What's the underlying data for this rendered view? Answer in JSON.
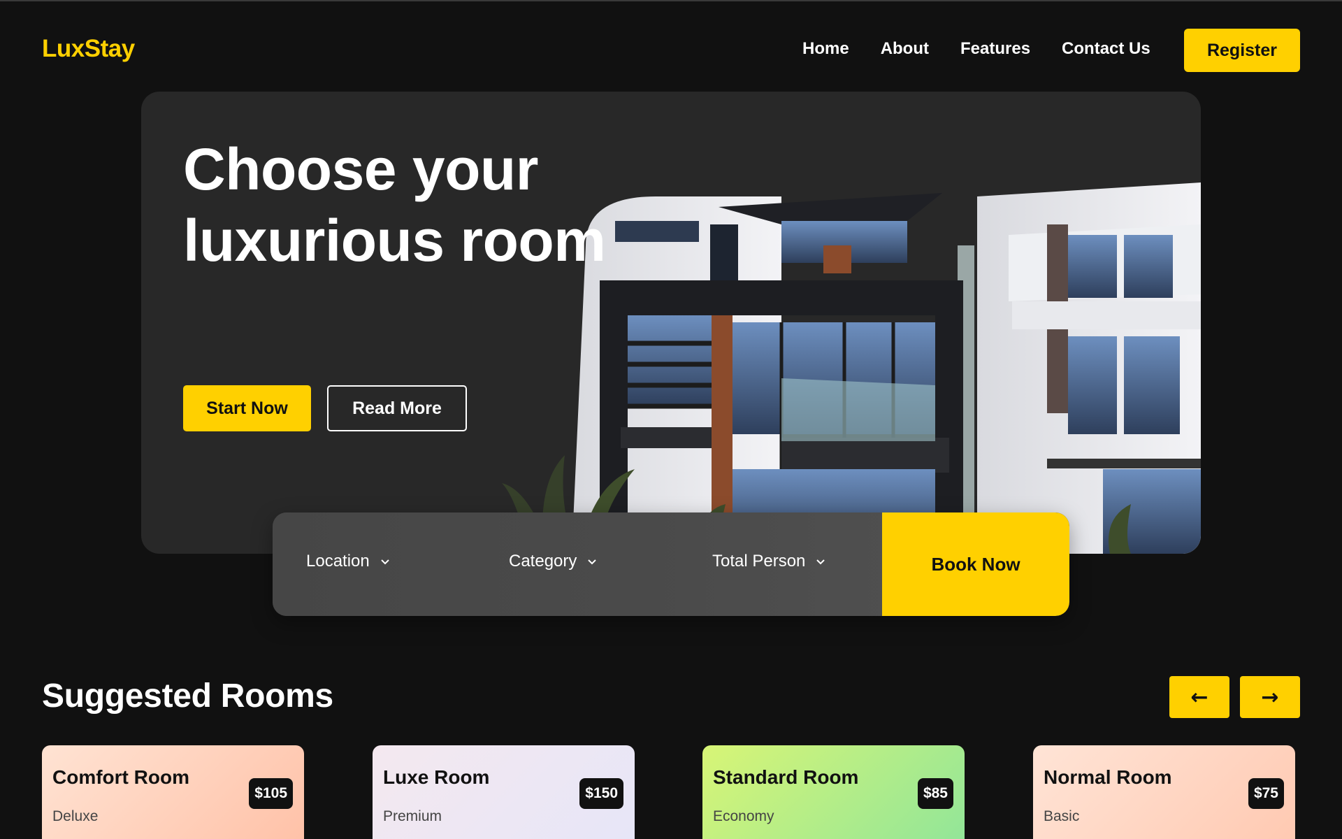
{
  "brand": {
    "logo": "LuxStay",
    "accent": "#ffd000",
    "background": "#111111"
  },
  "nav": {
    "items": [
      "Home",
      "About",
      "Features",
      "Contact Us"
    ],
    "register_label": "Register"
  },
  "hero": {
    "title": "Choose your luxurious room",
    "start_label": "Start Now",
    "read_label": "Read More",
    "image": "modern-building-photo"
  },
  "search": {
    "location_label": "Location",
    "category_label": "Category",
    "persons_label": "Total Person",
    "book_label": "Book Now"
  },
  "suggested": {
    "title": "Suggested Rooms",
    "prev_icon": "←",
    "next_icon": "→",
    "rooms": [
      {
        "name": "Comfort Room",
        "category": "Deluxe",
        "price": "$105"
      },
      {
        "name": "Luxe Room",
        "category": "Premium",
        "price": "$150"
      },
      {
        "name": "Standard Room",
        "category": "Economy",
        "price": "$85"
      },
      {
        "name": "Normal Room",
        "category": "Basic",
        "price": "$75"
      }
    ]
  }
}
